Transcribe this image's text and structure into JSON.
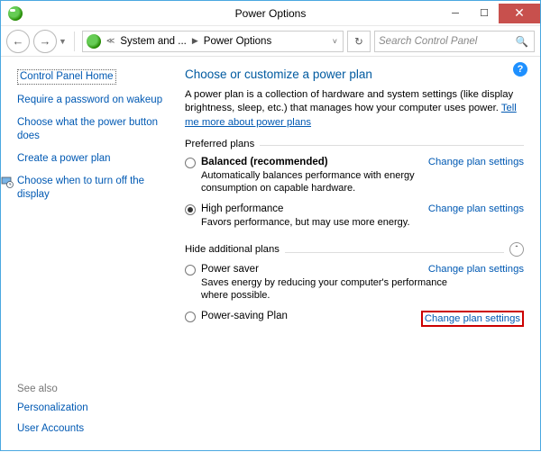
{
  "window": {
    "title": "Power Options"
  },
  "toolbar": {
    "breadcrumb": {
      "seg1": "System and ...",
      "seg2": "Power Options"
    },
    "search_placeholder": "Search Control Panel"
  },
  "sidebar": {
    "home": "Control Panel Home",
    "items": [
      "Require a password on wakeup",
      "Choose what the power button does",
      "Create a power plan",
      "Choose when to turn off the display"
    ],
    "see_also_hdr": "See also",
    "see_also": [
      "Personalization",
      "User Accounts"
    ]
  },
  "main": {
    "heading": "Choose or customize a power plan",
    "desc_text": "A power plan is a collection of hardware and system settings (like display brightness, sleep, etc.) that manages how your computer uses power. ",
    "desc_link": "Tell me more about power plans",
    "preferred_hdr": "Preferred plans",
    "hide_hdr": "Hide additional plans",
    "change_link": "Change plan settings",
    "plans": [
      {
        "name": "Balanced (recommended)",
        "desc": "Automatically balances performance with energy consumption on capable hardware.",
        "bold": true,
        "checked": false
      },
      {
        "name": "High performance",
        "desc": "Favors performance, but may use more energy.",
        "bold": false,
        "checked": true
      },
      {
        "name": "Power saver",
        "desc": "Saves energy by reducing your computer's performance where possible.",
        "bold": false,
        "checked": false
      },
      {
        "name": "Power-saving Plan",
        "desc": "",
        "bold": false,
        "checked": false
      }
    ]
  }
}
